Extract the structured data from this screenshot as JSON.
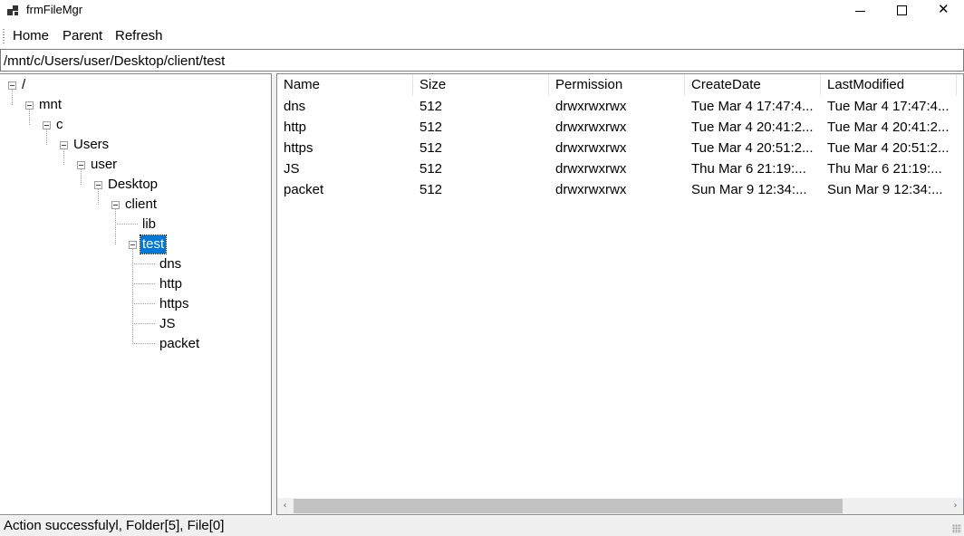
{
  "window": {
    "title": "frmFileMgr",
    "controls": {
      "minimize": "minimize-icon",
      "maximize": "maximize-icon",
      "close": "close-icon"
    }
  },
  "menu": {
    "items": [
      {
        "label": "Home"
      },
      {
        "label": "Parent"
      },
      {
        "label": "Refresh"
      }
    ]
  },
  "path": {
    "value": "/mnt/c/Users/user/Desktop/client/test"
  },
  "tree": {
    "nodes": [
      {
        "label": "/",
        "expanded": true
      },
      {
        "label": "mnt",
        "expanded": true
      },
      {
        "label": "c",
        "expanded": true
      },
      {
        "label": "Users",
        "expanded": true
      },
      {
        "label": "user",
        "expanded": true
      },
      {
        "label": "Desktop",
        "expanded": true
      },
      {
        "label": "client",
        "expanded": true
      },
      {
        "label": "lib"
      },
      {
        "label": "test",
        "expanded": true,
        "selected": true
      },
      {
        "label": "dns"
      },
      {
        "label": "http"
      },
      {
        "label": "https"
      },
      {
        "label": "JS"
      },
      {
        "label": "packet"
      }
    ]
  },
  "list": {
    "columns": [
      "Name",
      "Size",
      "Permission",
      "CreateDate",
      "LastModified"
    ],
    "rows": [
      [
        "dns",
        "512",
        "drwxrwxrwx",
        "Tue Mar  4 17:47:4...",
        "Tue Mar  4 17:47:4..."
      ],
      [
        "http",
        "512",
        "drwxrwxrwx",
        "Tue Mar  4 20:41:2...",
        "Tue Mar  4 20:41:2..."
      ],
      [
        "https",
        "512",
        "drwxrwxrwx",
        "Tue Mar  4 20:51:2...",
        "Tue Mar  4 20:51:2..."
      ],
      [
        "JS",
        "512",
        "drwxrwxrwx",
        "Thu Mar  6 21:19:...",
        "Thu Mar  6 21:19:..."
      ],
      [
        "packet",
        "512",
        "drwxrwxrwx",
        "Sun Mar  9 12:34:...",
        "Sun Mar  9 12:34:..."
      ]
    ],
    "scroll_left_arrow": "‹",
    "scroll_right_arrow": "›"
  },
  "status": {
    "text": "Action successfulyl, Folder[5], File[0]"
  },
  "colors": {
    "selection": "#0078d7",
    "status_bg": "#f0f0f0",
    "scroll_thumb": "#c2c2c2"
  }
}
